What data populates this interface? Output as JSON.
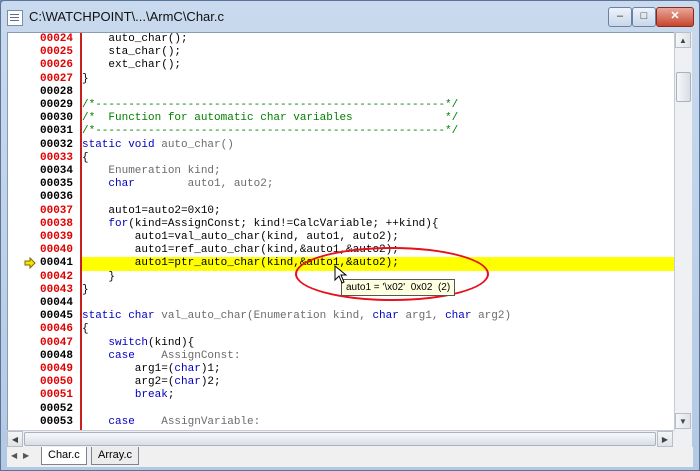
{
  "window": {
    "title": "C:\\WATCHPOINT\\...\\ArmC\\Char.c"
  },
  "controls": {
    "minimize": "–",
    "maximize": "□",
    "close": "✕"
  },
  "lines": [
    {
      "num": "00024",
      "red": true,
      "segs": [
        {
          "t": "    auto_char();"
        }
      ]
    },
    {
      "num": "00025",
      "red": true,
      "segs": [
        {
          "t": "    sta_char();"
        }
      ]
    },
    {
      "num": "00026",
      "red": true,
      "segs": [
        {
          "t": "    ext_char();"
        }
      ]
    },
    {
      "num": "00027",
      "red": true,
      "segs": [
        {
          "t": "}"
        }
      ]
    },
    {
      "num": "00028",
      "red": false,
      "segs": [
        {
          "t": ""
        }
      ]
    },
    {
      "num": "00029",
      "red": false,
      "segs": [
        {
          "t": "/*-----------------------------------------------------*/",
          "c": "cm"
        }
      ]
    },
    {
      "num": "00030",
      "red": false,
      "segs": [
        {
          "t": "/*  Function for automatic char variables              */",
          "c": "cm"
        }
      ]
    },
    {
      "num": "00031",
      "red": false,
      "segs": [
        {
          "t": "/*-----------------------------------------------------*/",
          "c": "cm"
        }
      ]
    },
    {
      "num": "00032",
      "red": false,
      "segs": [
        {
          "t": "static void ",
          "c": "kw"
        },
        {
          "t": "auto_char()",
          "c": "gray"
        }
      ]
    },
    {
      "num": "00033",
      "red": true,
      "segs": [
        {
          "t": "{"
        }
      ]
    },
    {
      "num": "00034",
      "red": false,
      "segs": [
        {
          "t": "    Enumeration kind;",
          "c": "gray"
        }
      ]
    },
    {
      "num": "00035",
      "red": false,
      "segs": [
        {
          "t": "    "
        },
        {
          "t": "char",
          "c": "kw"
        },
        {
          "t": "        auto1, auto2;",
          "c": "gray"
        }
      ]
    },
    {
      "num": "00036",
      "red": false,
      "segs": [
        {
          "t": ""
        }
      ]
    },
    {
      "num": "00037",
      "red": true,
      "segs": [
        {
          "t": "    auto1=auto2=0x10;"
        }
      ]
    },
    {
      "num": "00038",
      "red": true,
      "segs": [
        {
          "t": "    "
        },
        {
          "t": "for",
          "c": "kw"
        },
        {
          "t": "(kind=AssignConst; kind!=CalcVariable; ++kind){"
        }
      ]
    },
    {
      "num": "00039",
      "red": true,
      "segs": [
        {
          "t": "        auto1=val_auto_char(kind, auto1, auto2);"
        }
      ]
    },
    {
      "num": "00040",
      "red": true,
      "segs": [
        {
          "t": "        auto1=ref_auto_char(kind,&auto1,&auto2);"
        }
      ]
    },
    {
      "num": "00041",
      "red": false,
      "hl": true,
      "segs": [
        {
          "t": "        auto1=ptr_auto_char(kind,&auto1,&auto2);"
        }
      ]
    },
    {
      "num": "00042",
      "red": true,
      "segs": [
        {
          "t": "    }"
        }
      ]
    },
    {
      "num": "00043",
      "red": true,
      "segs": [
        {
          "t": "}"
        }
      ]
    },
    {
      "num": "00044",
      "red": false,
      "segs": [
        {
          "t": ""
        }
      ]
    },
    {
      "num": "00045",
      "red": false,
      "segs": [
        {
          "t": "static char ",
          "c": "kw"
        },
        {
          "t": "val_auto_char(Enumeration kind, ",
          "c": "gray"
        },
        {
          "t": "char",
          "c": "kw"
        },
        {
          "t": " arg1, ",
          "c": "gray"
        },
        {
          "t": "char",
          "c": "kw"
        },
        {
          "t": " arg2)",
          "c": "gray"
        }
      ]
    },
    {
      "num": "00046",
      "red": true,
      "segs": [
        {
          "t": "{"
        }
      ]
    },
    {
      "num": "00047",
      "red": true,
      "segs": [
        {
          "t": "    "
        },
        {
          "t": "switch",
          "c": "kw"
        },
        {
          "t": "(kind){"
        }
      ]
    },
    {
      "num": "00048",
      "red": false,
      "segs": [
        {
          "t": "    "
        },
        {
          "t": "case",
          "c": "kw"
        },
        {
          "t": "    AssignConst:",
          "c": "gray"
        }
      ]
    },
    {
      "num": "00049",
      "red": true,
      "segs": [
        {
          "t": "        arg1=("
        },
        {
          "t": "char",
          "c": "kw"
        },
        {
          "t": ")1;"
        }
      ]
    },
    {
      "num": "00050",
      "red": true,
      "segs": [
        {
          "t": "        arg2=("
        },
        {
          "t": "char",
          "c": "kw"
        },
        {
          "t": ")2;"
        }
      ]
    },
    {
      "num": "00051",
      "red": true,
      "segs": [
        {
          "t": "        "
        },
        {
          "t": "break",
          "c": "kw"
        },
        {
          "t": ";"
        }
      ]
    },
    {
      "num": "00052",
      "red": false,
      "segs": [
        {
          "t": ""
        }
      ]
    },
    {
      "num": "00053",
      "red": false,
      "segs": [
        {
          "t": "    "
        },
        {
          "t": "case",
          "c": "kw"
        },
        {
          "t": "    AssignVariable:",
          "c": "gray"
        }
      ]
    }
  ],
  "current_line": "00041",
  "tooltip": {
    "text": "auto1 = '\\x02'  0x02  (2)"
  },
  "tabs": [
    {
      "label": "Char.c",
      "active": true
    },
    {
      "label": "Array.c",
      "active": false
    }
  ],
  "colors": {
    "keyword": "#0000c0",
    "comment": "#008000",
    "highlight": "#ffff00",
    "line_number_red": "#e00000",
    "callout": "#e8101a"
  }
}
